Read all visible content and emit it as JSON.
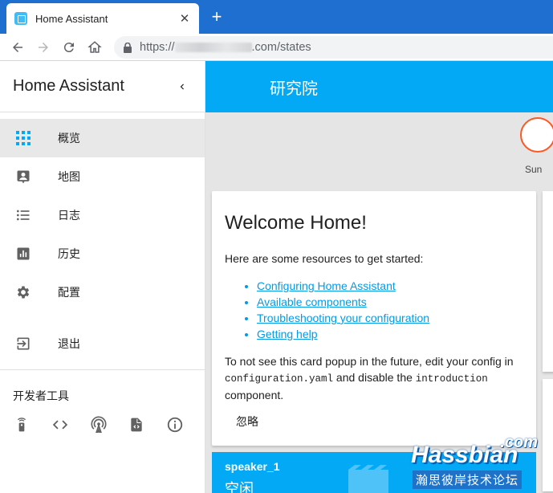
{
  "browser": {
    "tab_title": "Home Assistant",
    "tab_close": "✕",
    "new_tab": "+",
    "url_prefix": "https://",
    "url_suffix": ".com/states"
  },
  "sidebar": {
    "title": "Home Assistant",
    "items": [
      {
        "label": "概览",
        "icon": "apps-icon",
        "active": true
      },
      {
        "label": "地图",
        "icon": "account-box-icon"
      },
      {
        "label": "日志",
        "icon": "format-list-bulleted-icon"
      },
      {
        "label": "历史",
        "icon": "chart-box-icon"
      },
      {
        "label": "配置",
        "icon": "settings-icon"
      }
    ],
    "logout_label": "退出",
    "dev_tools_title": "开发者工具",
    "dev_tools": [
      "remote-icon",
      "code-tags-icon",
      "antenna-icon",
      "file-code-icon",
      "info-icon"
    ]
  },
  "main": {
    "title": "研究院",
    "sun_badge_label": "Sun",
    "welcome_card": {
      "title": "Welcome Home!",
      "intro": "Here are some resources to get started:",
      "links": [
        "Configuring Home Assistant",
        "Available components",
        "Troubleshooting your configuration",
        "Getting help"
      ],
      "footer_pre": "To not see this card popup in the future, edit your config in",
      "footer_file": "configuration.yaml",
      "footer_mid": " and disable the ",
      "footer_comp": "introduction",
      "footer_post": "component.",
      "dismiss_label": "忽略"
    },
    "media_card": {
      "name": "speaker_1",
      "state": "空闲"
    }
  },
  "watermark": {
    "top": ".com",
    "main": "Hassbian",
    "sub": "瀚思彼岸技术论坛"
  },
  "colors": {
    "accent": "#03a9f4",
    "browser_chrome": "#1f6fd0",
    "sun_ring": "#ff5722",
    "link": "#039be5"
  }
}
